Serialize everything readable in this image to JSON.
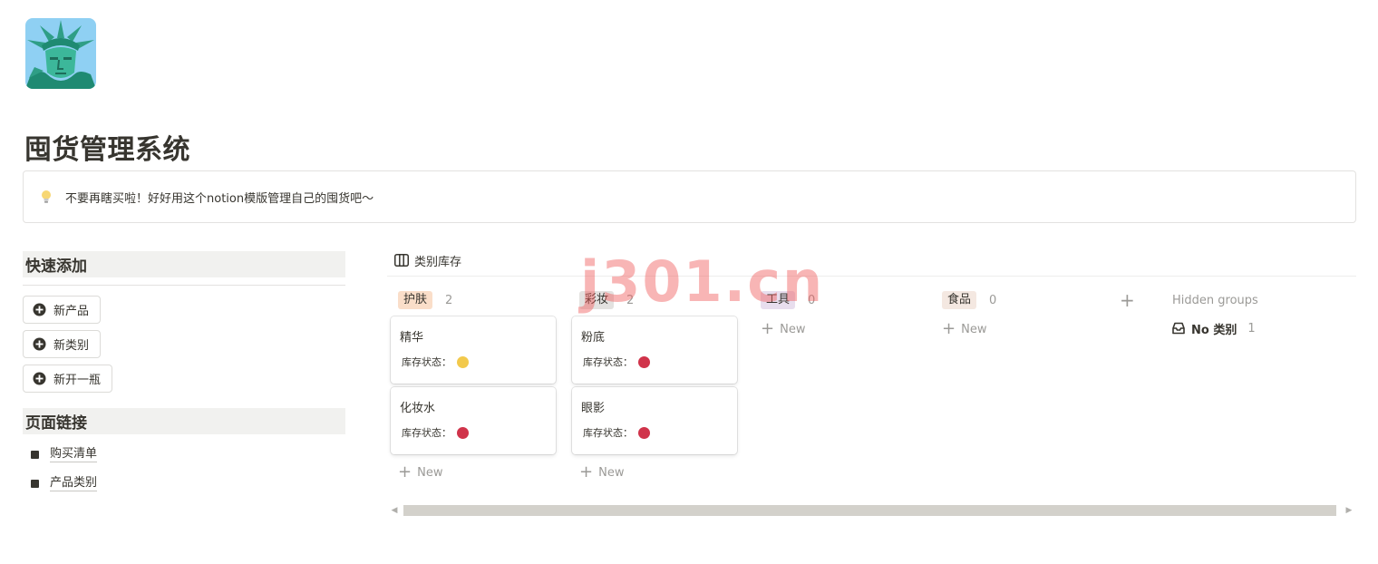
{
  "page": {
    "title": "囤货管理系统",
    "icon": "statue-of-liberty-icon"
  },
  "callout": {
    "icon": "light-bulb-icon",
    "text": "不要再瞎买啦！好好用这个notion模版管理自己的囤货吧～"
  },
  "quick_add": {
    "heading": "快速添加",
    "buttons": [
      {
        "label": "新产品",
        "icon": "plus-circle-icon"
      },
      {
        "label": "新类别",
        "icon": "plus-circle-icon"
      },
      {
        "label": "新开一瓶",
        "icon": "plus-circle-icon"
      }
    ]
  },
  "page_links": {
    "heading": "页面链接",
    "items": [
      {
        "label": "购买清单"
      },
      {
        "label": "产品类别"
      }
    ]
  },
  "board": {
    "view_label": "类别库存",
    "view_icon": "board-view-icon",
    "columns": [
      {
        "name": "护肤",
        "count": "2",
        "tag_color": "#fadec9",
        "cards": [
          {
            "title": "精华",
            "prop_label": "库存状态：",
            "status_color": "#f2c94c"
          },
          {
            "title": "化妆水",
            "prop_label": "库存状态：",
            "status_color": "#d0334a"
          }
        ]
      },
      {
        "name": "彩妆",
        "count": "2",
        "tag_color": "#e3e2e0",
        "cards": [
          {
            "title": "粉底",
            "prop_label": "库存状态：",
            "status_color": "#d0334a"
          },
          {
            "title": "眼影",
            "prop_label": "库存状态：",
            "status_color": "#d0334a"
          }
        ]
      },
      {
        "name": "工具",
        "count": "0",
        "tag_color": "#e8deee",
        "cards": []
      },
      {
        "name": "食品",
        "count": "0",
        "tag_color": "#f4e8e1",
        "cards": []
      }
    ],
    "new_label": "New",
    "hidden_groups": {
      "title": "Hidden groups",
      "items": [
        {
          "label": "No 类别",
          "count": "1",
          "icon": "inbox-icon"
        }
      ]
    }
  },
  "watermark": {
    "text": "j301.cn"
  }
}
